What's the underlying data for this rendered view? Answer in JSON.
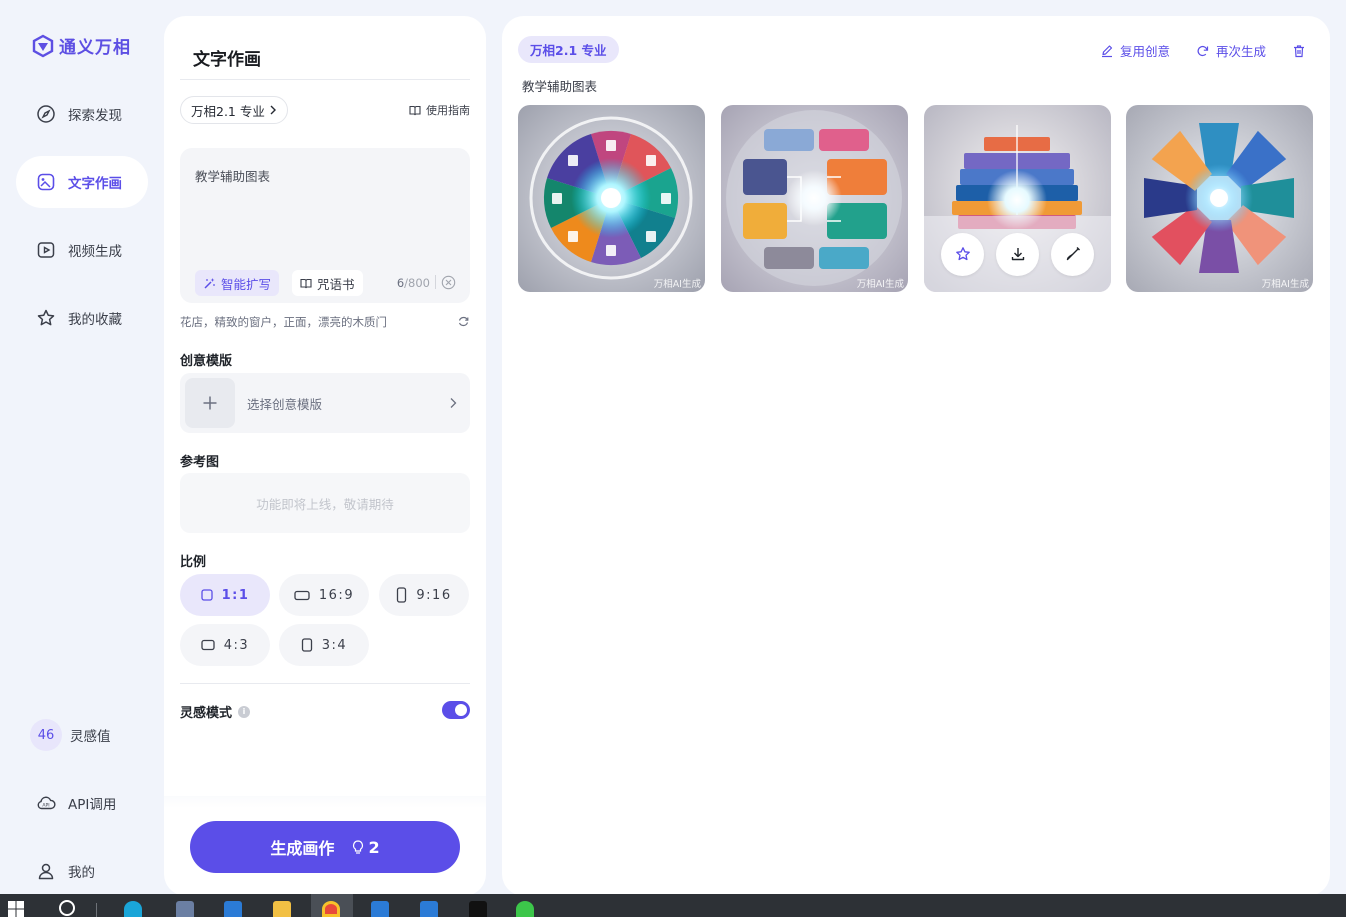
{
  "app": {
    "name": "通义万相"
  },
  "nav": {
    "items": [
      {
        "label": "探索发现",
        "icon": "compass-icon"
      },
      {
        "label": "文字作画",
        "icon": "image-edit-icon"
      },
      {
        "label": "视频生成",
        "icon": "video-play-icon"
      },
      {
        "label": "我的收藏",
        "icon": "star-icon"
      }
    ],
    "bottom": {
      "lingan_count": "46",
      "lingan_label": "灵感值",
      "api_label": "API调用",
      "me_label": "我的"
    }
  },
  "panel": {
    "title": "文字作画",
    "model": "万相2.1 专业",
    "guide": "使用指南",
    "prompt": "教学辅助图表",
    "expand_label": "智能扩写",
    "spell_label": "咒语书",
    "char_count": "6",
    "char_max": "/800",
    "suggestion": "花店，精致的窗户，正面，漂亮的木质门",
    "template_section": "创意模版",
    "template_placeholder": "选择创意模版",
    "reference_section": "参考图",
    "reference_placeholder": "功能即将上线，敬请期待",
    "ratio_section": "比例",
    "ratios": [
      {
        "label": "1:1",
        "selected": true
      },
      {
        "label": "16:9",
        "selected": false
      },
      {
        "label": "9:16",
        "selected": false
      },
      {
        "label": "4:3",
        "selected": false
      },
      {
        "label": "3:4",
        "selected": false
      }
    ],
    "inspiration_label": "灵感模式",
    "inspiration_enabled": true,
    "generate_label": "生成画作",
    "generate_cost": "2"
  },
  "results": {
    "model_tag": "万相2.1 专业",
    "actions": {
      "reuse": "复用创意",
      "regenerate": "再次生成"
    },
    "prompt": "教学辅助图表",
    "watermark": "万相AI生成",
    "images": [
      {
        "name": "radial-infographic-1"
      },
      {
        "name": "tiles-infographic-2"
      },
      {
        "name": "stacked-infographic-3",
        "hovered": true
      },
      {
        "name": "flower-infographic-4"
      }
    ]
  },
  "colors": {
    "accent": "#5b4ee8",
    "accent_soft": "#e9e7fb",
    "background": "#f1f4fb"
  }
}
